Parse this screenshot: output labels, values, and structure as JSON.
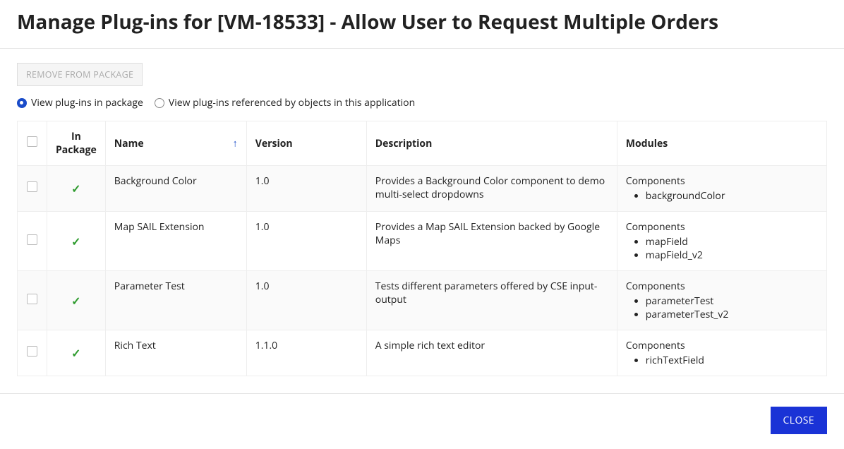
{
  "header": {
    "title": "Manage Plug-ins for [VM-18533] - Allow User to Request Multiple Orders"
  },
  "toolbar": {
    "remove_button_label": "REMOVE FROM PACKAGE",
    "radio_in_package_label": "View plug-ins in package",
    "radio_referenced_label": "View plug-ins referenced by objects in this application",
    "selected_radio": "in_package"
  },
  "table": {
    "headers": {
      "in_package": "In Package",
      "name": "Name",
      "version": "Version",
      "description": "Description",
      "modules": "Modules"
    },
    "sort": {
      "column": "name",
      "direction": "asc"
    },
    "modules_group_label": "Components",
    "rows": [
      {
        "in_package": true,
        "name": "Background Color",
        "version": "1.0",
        "description": "Provides a Background Color component to demo multi-select dropdowns",
        "modules": [
          "backgroundColor"
        ]
      },
      {
        "in_package": true,
        "name": "Map SAIL Extension",
        "version": "1.0",
        "description": "Provides a Map SAIL Extension backed by Google Maps",
        "modules": [
          "mapField",
          "mapField_v2"
        ]
      },
      {
        "in_package": true,
        "name": "Parameter Test",
        "version": "1.0",
        "description": "Tests different parameters offered by CSE input-output",
        "modules": [
          "parameterTest",
          "parameterTest_v2"
        ]
      },
      {
        "in_package": true,
        "name": "Rich Text",
        "version": "1.1.0",
        "description": "A simple rich text editor",
        "modules": [
          "richTextField"
        ]
      }
    ]
  },
  "footer": {
    "close_label": "CLOSE"
  }
}
